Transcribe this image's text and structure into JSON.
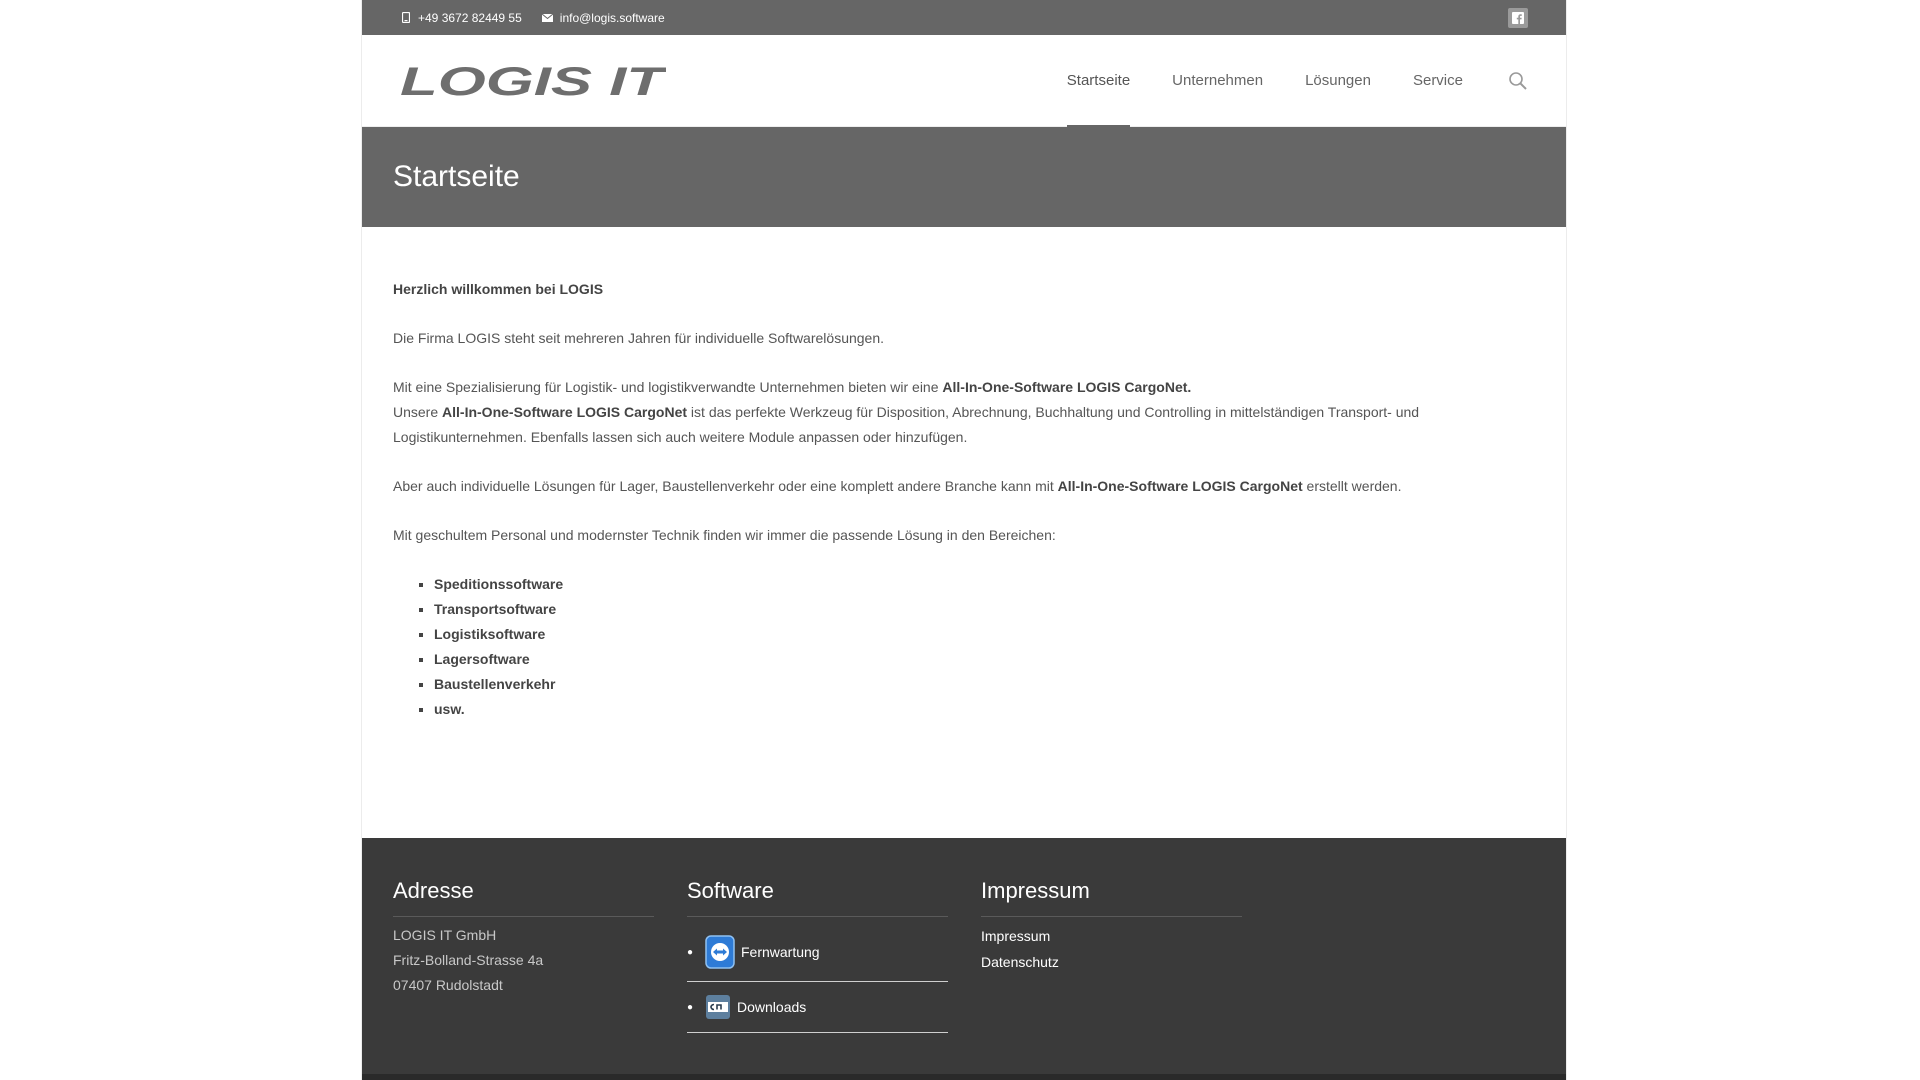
{
  "topbar": {
    "phone": "+49 3672 82449 55",
    "email": "info@logis.software",
    "social_icon": "facebook-icon"
  },
  "header": {
    "logo_text": "LOGIS IT",
    "nav": [
      {
        "label": "Startseite",
        "active": true
      },
      {
        "label": "Unternehmen",
        "active": false
      },
      {
        "label": "Lösungen",
        "active": false
      },
      {
        "label": "Service",
        "active": false
      }
    ],
    "search_icon": "search-icon"
  },
  "page_title": "Startseite",
  "content": {
    "welcome": "Herzlich willkommen bei LOGIS",
    "p1": "Die Firma LOGIS steht seit mehreren Jahren für individuelle Softwarelösungen.",
    "p2_a": "Mit eine Spezialisierung für Logistik- und logistikverwandte Unternehmen bieten wir eine ",
    "p2_b": "All-In-One-Software LOGIS CargoNet.",
    "p2_c": "Unsere ",
    "p2_d": "All-In-One-Software LOGIS CargoNet",
    "p2_e": " ist das perfekte Werkzeug für Disposition, Abrechnung, Buchhaltung und Controlling in mittelständigen Transport- und Logistikunternehmen. Ebenfalls lassen sich auch weitere Module anpassen oder hinzufügen.",
    "p3_a": "Aber auch individuelle Lösungen für Lager, Baustellenverkehr oder eine komplett andere Branche kann mit ",
    "p3_b": "All-In-One-Software LOGIS CargoNet",
    "p3_c": " erstellt werden.",
    "p4": "Mit geschultem Personal und modernster Technik finden wir immer die passende Lösung in den Bereichen:",
    "list": [
      "Speditionssoftware",
      "Transportsoftware",
      "Logistiksoftware",
      "Lagersoftware",
      "Baustellenverkehr",
      "usw."
    ]
  },
  "footer": {
    "address": {
      "title": "Adresse",
      "lines": [
        "LOGIS IT GmbH",
        "Fritz-Bolland-Strasse 4a",
        "07407 Rudolstadt"
      ]
    },
    "software": {
      "title": "Software",
      "items": [
        {
          "label": "Fernwartung",
          "icon": "teamviewer-icon"
        },
        {
          "label": "Downloads",
          "icon": "cargonet-icon"
        }
      ]
    },
    "impressum": {
      "title": "Impressum",
      "links": [
        "Impressum",
        "Datenschutz"
      ]
    }
  },
  "colors": {
    "topbar": "#666666",
    "titlebar": "#666666",
    "footer": "#3a3a3a",
    "accent": "#666666"
  }
}
